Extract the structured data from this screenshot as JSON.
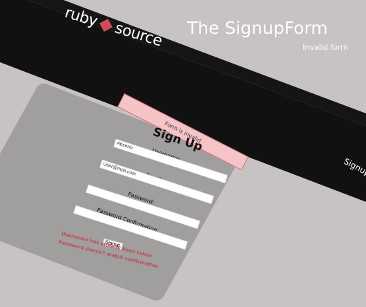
{
  "header": {
    "brand_left": "ruby",
    "brand_right": "source",
    "nav_text": "Signup"
  },
  "site": {
    "title": "The SignupForm",
    "subtitle": "Invalid form"
  },
  "flash": {
    "message": "Form is invalid"
  },
  "form": {
    "title": "Sign Up",
    "username_label": "Username:",
    "username_value": "Abserio",
    "email_label": "Email:",
    "email_value": "User@mail.com",
    "password_label": "Password:",
    "password_value": "",
    "confirmation_label": "Password Confirmation:",
    "confirmation_value": "",
    "submit_label": "Signup",
    "errors": [
      "Username has already been taken",
      "Password doesn't match confirmation"
    ]
  },
  "colors": {
    "band": "#111111",
    "background": "#c8c3c3",
    "card": "#a19e9e",
    "flash_bg": "#f4c4c7",
    "error": "#c24a54",
    "gem": "#cf4b53"
  }
}
